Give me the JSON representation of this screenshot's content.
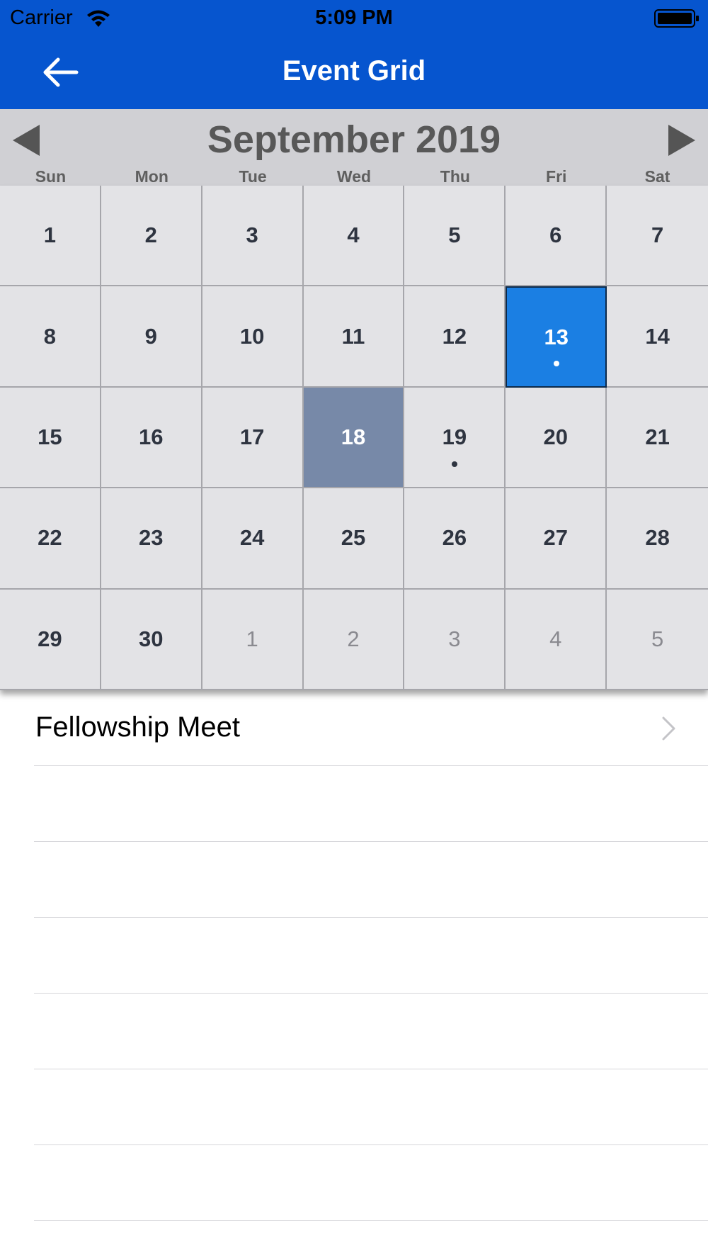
{
  "status_bar": {
    "carrier": "Carrier",
    "time": "5:09 PM",
    "icons": [
      "wifi-icon",
      "battery-icon"
    ]
  },
  "nav": {
    "title": "Event Grid",
    "back_icon": "arrow-left-icon"
  },
  "colors": {
    "nav_bg": "#0655cf",
    "header_bg": "#d0d0d4",
    "cell_bg": "#e3e3e6",
    "selected_bg": "#1b7fe3",
    "today_bg": "#7789a8"
  },
  "calendar": {
    "month_title": "September 2019",
    "prev_icon": "triangle-left-icon",
    "next_icon": "triangle-right-icon",
    "weekdays": [
      "Sun",
      "Mon",
      "Tue",
      "Wed",
      "Thu",
      "Fri",
      "Sat"
    ],
    "days": [
      {
        "label": "1"
      },
      {
        "label": "2"
      },
      {
        "label": "3"
      },
      {
        "label": "4"
      },
      {
        "label": "5"
      },
      {
        "label": "6"
      },
      {
        "label": "7"
      },
      {
        "label": "8"
      },
      {
        "label": "9"
      },
      {
        "label": "10"
      },
      {
        "label": "11"
      },
      {
        "label": "12"
      },
      {
        "label": "13",
        "selected": true,
        "has_event": true
      },
      {
        "label": "14"
      },
      {
        "label": "15"
      },
      {
        "label": "16"
      },
      {
        "label": "17"
      },
      {
        "label": "18",
        "today": true
      },
      {
        "label": "19",
        "has_event": true
      },
      {
        "label": "20"
      },
      {
        "label": "21"
      },
      {
        "label": "22"
      },
      {
        "label": "23"
      },
      {
        "label": "24"
      },
      {
        "label": "25"
      },
      {
        "label": "26"
      },
      {
        "label": "27"
      },
      {
        "label": "28"
      },
      {
        "label": "29"
      },
      {
        "label": "30"
      },
      {
        "label": "1",
        "other_month": true
      },
      {
        "label": "2",
        "other_month": true
      },
      {
        "label": "3",
        "other_month": true
      },
      {
        "label": "4",
        "other_month": true
      },
      {
        "label": "5",
        "other_month": true
      }
    ]
  },
  "events": [
    {
      "title": "Fellowship Meet",
      "icon": "chevron-right-icon"
    }
  ],
  "empty_rows": 6
}
